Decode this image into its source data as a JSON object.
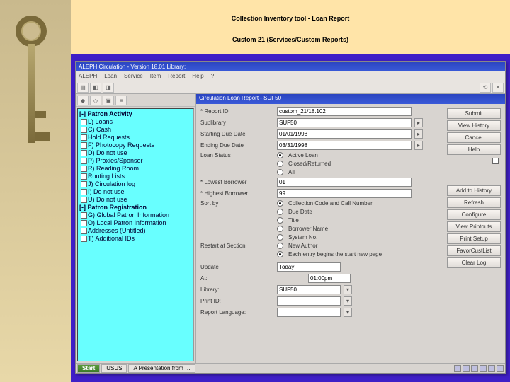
{
  "slide_title_l1": "Collection Inventory tool - Loan Report",
  "slide_title_l2": "Custom 21 (Services/Custom Reports)",
  "titlebar": {
    "app": "ALEPH Circulation - Version 18.01  Library:",
    "dialog": "Circulation Loan Report - SUF50"
  },
  "menu": {
    "m0": "ALEPH",
    "m1": "Loan",
    "m2": "Service",
    "m3": "Item",
    "m4": "Report",
    "m5": "Help",
    "m6": "?"
  },
  "tree": {
    "h1": "[-] Patron Activity",
    "i1": "L) Loans",
    "i2": "C) Cash",
    "i3": "Hold Requests",
    "i4": "F) Photocopy Requests",
    "i5": "D) Do not use",
    "i6": "P) Proxies/Sponsor",
    "i7": "R) Reading Room",
    "i8": "Routing Lists",
    "i9": "J) Circulation log",
    "i10": "I) Do not use",
    "i11": "U) Do not use",
    "h2": "[-] Patron Registration",
    "i12": "G) Global Patron Information",
    "i13": "O) Local Patron Information",
    "i14": "Addresses (Untitled)",
    "i15": "T) Additional IDs"
  },
  "form": {
    "report_id_lbl": "* Report ID",
    "report_id_val": "custom_21/18.102",
    "sublibrary_lbl": "Sublibrary",
    "sublibrary_val": "SUF50",
    "start_due_lbl": "Starting Due Date",
    "start_due_val": "01/01/1998",
    "end_due_lbl": "Ending Due Date",
    "end_due_val": "03/31/1998",
    "loan_status_lbl": "Loan Status",
    "opt_active": "Active Loan",
    "opt_closed": "Closed/Returned",
    "opt_all": "All",
    "lowest_lbl": "* Lowest Borrower",
    "lowest_val": "01",
    "highest_lbl": "* Highest Borrower",
    "highest_val": "99",
    "sort_lbl": "Sort by",
    "so1": "Collection Code and Call Number",
    "so2": "Due Date",
    "so3": "Title",
    "so4": "Borrower Name",
    "so5": "System No.",
    "restart_lbl": "Restart at Section",
    "ro1": "New Author",
    "ro2": "Each entry begins the start new page",
    "update_lbl": "Update",
    "update_val": "Today",
    "at_lbl": "At:",
    "at_val": "01:00pm",
    "library_lbl": "Library:",
    "library_val": "SUF50",
    "printid_lbl": "Print ID:",
    "printid_val": "",
    "lang_lbl": "Report Language:",
    "lang_val": ""
  },
  "buttons": {
    "submit": "Submit",
    "view_history": "View History",
    "cancel": "Cancel",
    "help": "Help",
    "add_to_history": "Add to History",
    "refresh": "Refresh",
    "configure": "Configure",
    "view_printouts": "View Printouts",
    "print_setup": "Print Setup",
    "savecustext": "FavorCustList",
    "clear": "Clear Log"
  },
  "taskbar": {
    "start": "Start",
    "t1": "USUS",
    "t2": "A Presentation from …"
  }
}
